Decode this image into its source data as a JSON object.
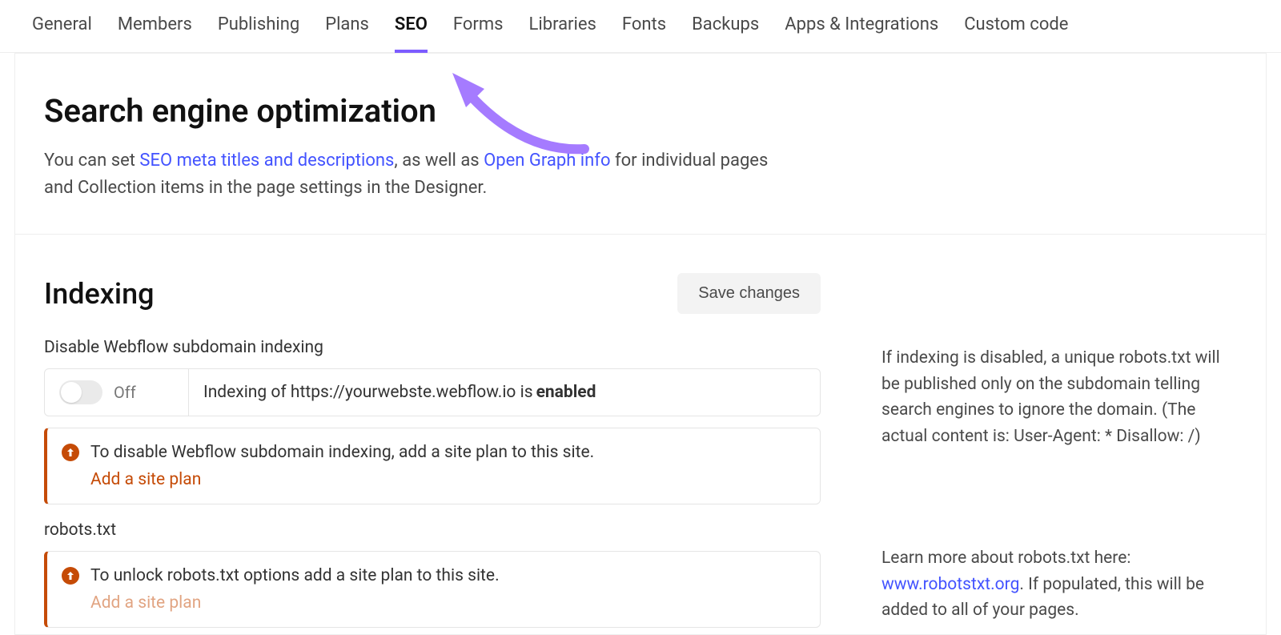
{
  "tabs": [
    {
      "label": "General"
    },
    {
      "label": "Members"
    },
    {
      "label": "Publishing"
    },
    {
      "label": "Plans"
    },
    {
      "label": "SEO"
    },
    {
      "label": "Forms"
    },
    {
      "label": "Libraries"
    },
    {
      "label": "Fonts"
    },
    {
      "label": "Backups"
    },
    {
      "label": "Apps & Integrations"
    },
    {
      "label": "Custom code"
    }
  ],
  "active_tab_index": 4,
  "header": {
    "title": "Search engine optimization",
    "intro_before": "You can set ",
    "intro_link1": "SEO meta titles and descriptions",
    "intro_mid": ", as well as ",
    "intro_link2": "Open Graph info",
    "intro_after": " for individual pages and Collection items in the page settings in the Designer."
  },
  "indexing": {
    "title": "Indexing",
    "save_label": "Save changes",
    "disable_label": "Disable Webflow subdomain indexing",
    "toggle_state": "Off",
    "status_text_prefix": "Indexing of https://yourwebste.webflow.io is ",
    "status_text_strong": "enabled",
    "callout1_text": "To disable Webflow subdomain indexing, add a site plan to this site.",
    "callout1_link": "Add a site plan",
    "robots_label": "robots.txt",
    "callout2_text": "To unlock robots.txt options add a site plan to this site.",
    "callout2_link": "Add a site plan",
    "help1": "If indexing is disabled, a unique robots.txt will be published only on the subdomain telling search engines to ignore the domain. (The actual content is: User-Agent: * Disallow: /)",
    "help2_before": "Learn more about robots.txt here: ",
    "help2_link": "www.robotstxt.org",
    "help2_after": ". If populated, this will be added to all of your pages."
  }
}
